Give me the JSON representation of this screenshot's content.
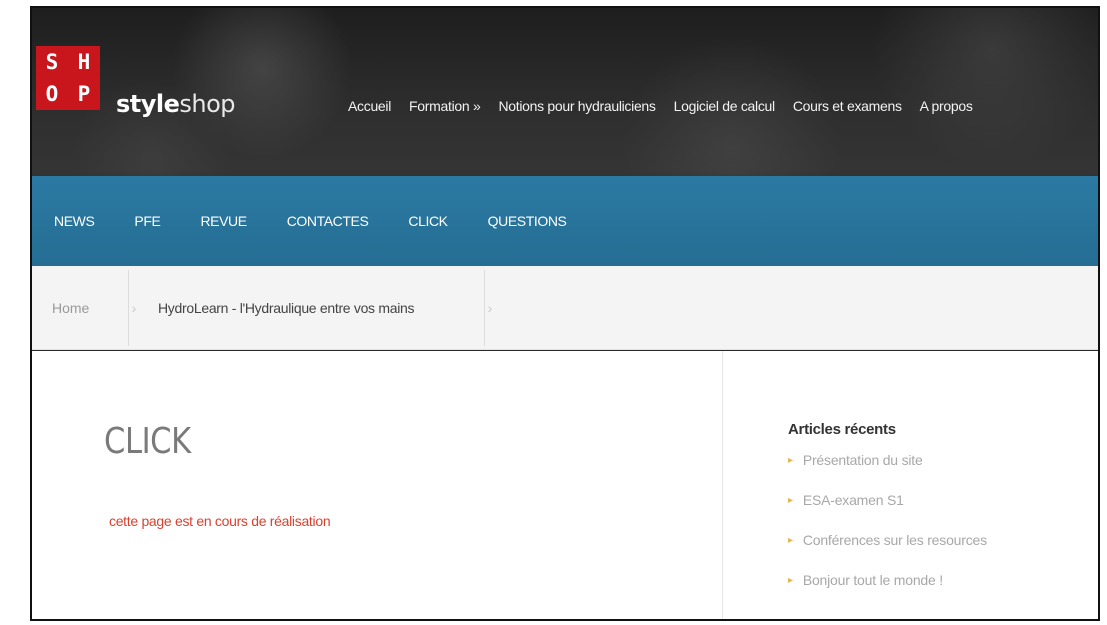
{
  "logo": {
    "letters": [
      "S",
      "H",
      "O",
      "P"
    ],
    "brand_bold": "style",
    "brand_light": "shop"
  },
  "main_nav": [
    {
      "label": "Accueil"
    },
    {
      "label": "Formation »"
    },
    {
      "label": "Notions pour hydrauliciens"
    },
    {
      "label": "Logiciel de calcul"
    },
    {
      "label": "Cours et examens"
    },
    {
      "label": "A propos"
    }
  ],
  "sub_nav": [
    {
      "label": "NEWS"
    },
    {
      "label": "PFE"
    },
    {
      "label": "REVUE"
    },
    {
      "label": "CONTACTES"
    },
    {
      "label": "CLICK"
    },
    {
      "label": "QUESTIONS"
    }
  ],
  "breadcrumb": {
    "home": "Home",
    "current": "HydroLearn - l'Hydraulique entre vos mains"
  },
  "page": {
    "title": "CLICK",
    "note": "cette page est en cours de réalisation"
  },
  "sidebar": {
    "heading": "Articles récents",
    "items": [
      {
        "label": "Présentation du site"
      },
      {
        "label": "ESA-examen S1"
      },
      {
        "label": "Conférences sur les resources"
      },
      {
        "label": "Bonjour tout le monde !"
      }
    ]
  },
  "colors": {
    "logo_red": "#c8161c",
    "nav_blue": "#2b7aa3",
    "note_red": "#d9412f",
    "bullet_gold": "#e2b84a"
  }
}
